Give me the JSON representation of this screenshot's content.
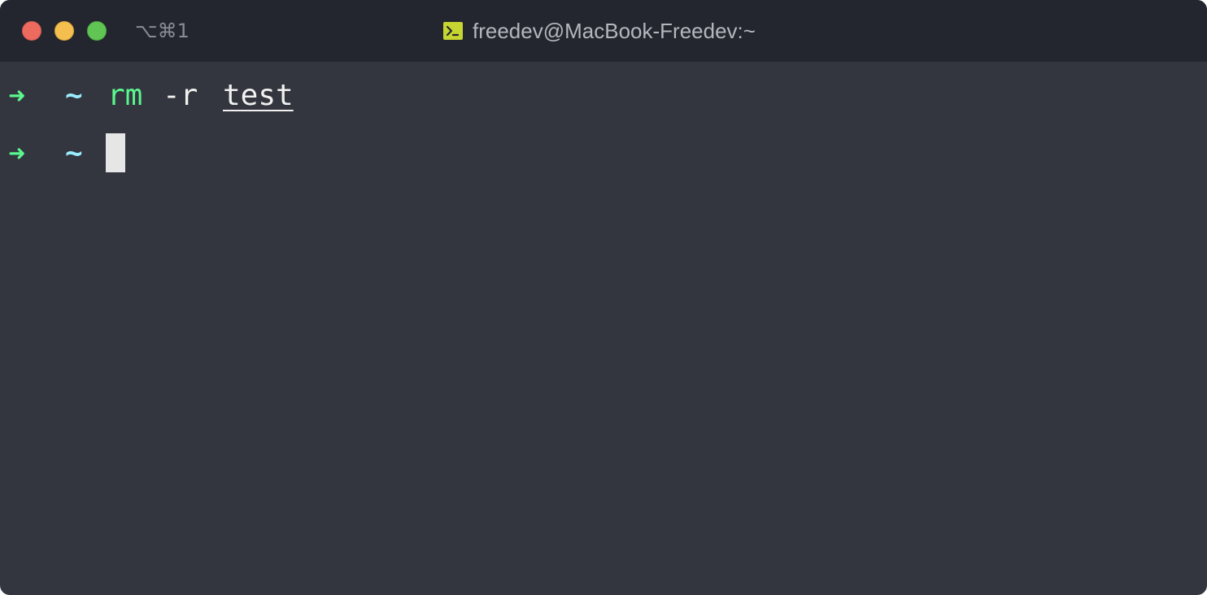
{
  "window": {
    "shortcut": "⌥⌘1",
    "title": "freedev@MacBook-Freedev:~",
    "title_icon": "terminal-icon",
    "traffic_lights": {
      "close_color": "#ed6a5e",
      "minimize_color": "#f5bf4f",
      "zoom_color": "#61c554"
    }
  },
  "terminal": {
    "colors": {
      "background": "#33353f",
      "arrow": "#5af78e",
      "tilde": "#9aedfe",
      "command": "#5af78e",
      "text": "#f1f1f0"
    },
    "lines": [
      {
        "arrow": "➜",
        "dir": "~",
        "command": "rm",
        "flag": "-r",
        "argument": "test"
      },
      {
        "arrow": "➜",
        "dir": "~"
      }
    ]
  }
}
